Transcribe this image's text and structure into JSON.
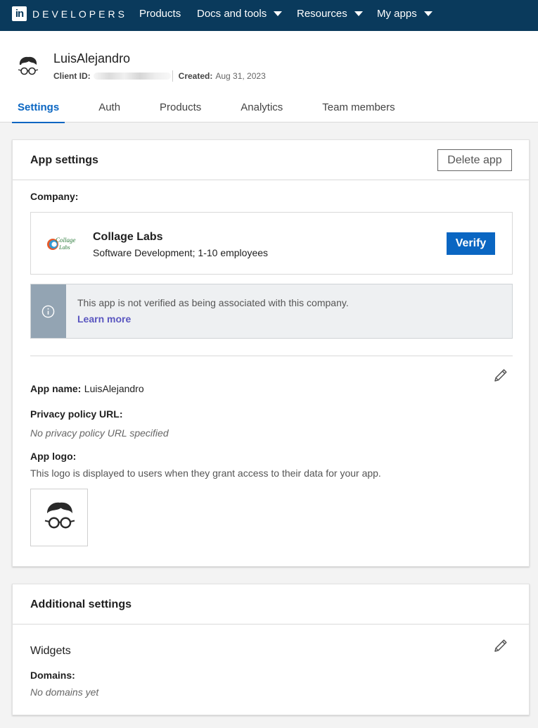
{
  "nav": {
    "logo_letters": "in",
    "brand": "DEVELOPERS",
    "items": [
      {
        "label": "Products",
        "dropdown": false
      },
      {
        "label": "Docs and tools",
        "dropdown": true
      },
      {
        "label": "Resources",
        "dropdown": true
      },
      {
        "label": "My apps",
        "dropdown": true
      }
    ]
  },
  "app": {
    "name": "LuisAlejandro",
    "client_id_label": "Client ID:",
    "created_label": "Created:",
    "created_value": "Aug 31, 2023"
  },
  "tabs": [
    {
      "label": "Settings",
      "active": true
    },
    {
      "label": "Auth",
      "active": false
    },
    {
      "label": "Products",
      "active": false
    },
    {
      "label": "Analytics",
      "active": false
    },
    {
      "label": "Team members",
      "active": false
    }
  ],
  "app_settings": {
    "title": "App settings",
    "delete_label": "Delete app",
    "company_label": "Company:",
    "company": {
      "name": "Collage Labs",
      "description": "Software Development; 1-10 employees",
      "verify_label": "Verify"
    },
    "notice": {
      "text": "This app is not verified as being associated with this company.",
      "link": "Learn more"
    },
    "app_name_label": "App name:",
    "app_name_value": "LuisAlejandro",
    "privacy_label": "Privacy policy URL:",
    "privacy_value": "No privacy policy URL specified",
    "logo_label": "App logo:",
    "logo_description": "This logo is displayed to users when they grant access to their data for your app."
  },
  "additional_settings": {
    "title": "Additional settings",
    "widgets_label": "Widgets",
    "domains_label": "Domains:",
    "domains_value": "No domains yet"
  },
  "colors": {
    "nav_bg": "#0a3a5c",
    "primary": "#0a66c2",
    "link": "#5a56c0"
  }
}
